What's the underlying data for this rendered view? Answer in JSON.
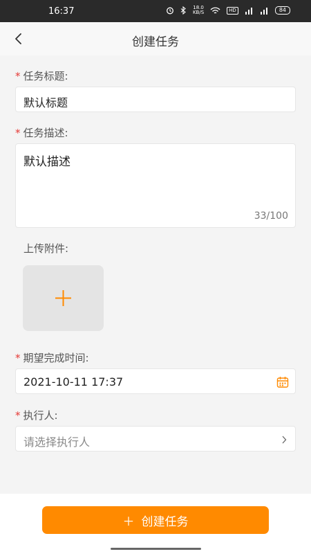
{
  "status_bar": {
    "time": "16:37",
    "speed_value": "18.0",
    "speed_unit": "KB/S",
    "hd_label": "HD",
    "battery": "84"
  },
  "header": {
    "title": "创建任务"
  },
  "form": {
    "required_mark": "*",
    "title_label": "任务标题:",
    "title_value": "默认标题",
    "desc_label": "任务描述:",
    "desc_value": "默认描述",
    "desc_counter": "33/100",
    "attach_label": "上传附件:",
    "due_label": "期望完成时间:",
    "due_value": "2021-10-11 17:37",
    "assignee_label": "执行人:",
    "assignee_placeholder": "请选择执行人"
  },
  "footer": {
    "submit_icon": "＋",
    "submit_label": "创建任务"
  },
  "colors": {
    "accent": "#ff8a00",
    "required": "#e53935"
  }
}
